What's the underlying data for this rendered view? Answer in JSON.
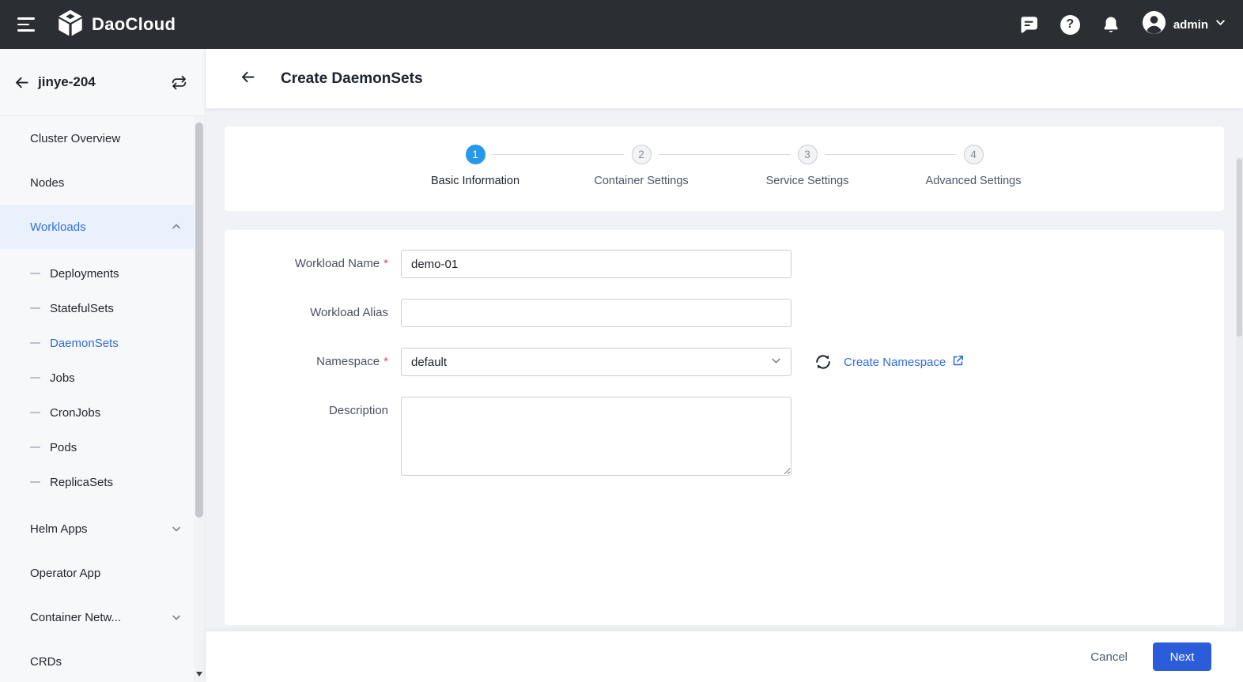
{
  "topbar": {
    "brand": "DaoCloud",
    "user": "admin",
    "icons": [
      "menu-icon",
      "cube-logo-icon",
      "chat-icon",
      "help-icon",
      "bell-icon",
      "avatar-icon",
      "chevron-down-icon"
    ]
  },
  "sidebar": {
    "cluster_name": "jinye-204",
    "header_icons": [
      "back-arrow-icon",
      "switch-cluster-icon"
    ],
    "items": [
      {
        "label": "Cluster Overview",
        "level": "top"
      },
      {
        "label": "Nodes",
        "level": "top"
      },
      {
        "label": "Workloads",
        "level": "top",
        "state": "expanded-active"
      },
      {
        "label": "Deployments",
        "level": "sub"
      },
      {
        "label": "StatefulSets",
        "level": "sub"
      },
      {
        "label": "DaemonSets",
        "level": "sub",
        "state": "selected"
      },
      {
        "label": "Jobs",
        "level": "sub"
      },
      {
        "label": "CronJobs",
        "level": "sub"
      },
      {
        "label": "Pods",
        "level": "sub"
      },
      {
        "label": "ReplicaSets",
        "level": "sub"
      },
      {
        "label": "Helm Apps",
        "level": "top",
        "state": "collapsed"
      },
      {
        "label": "Operator App",
        "level": "top"
      },
      {
        "label": "Container Netw...",
        "level": "top",
        "state": "collapsed"
      },
      {
        "label": "CRDs",
        "level": "top"
      }
    ]
  },
  "page": {
    "title": "Create DaemonSets"
  },
  "stepper": {
    "steps": [
      {
        "number": "1",
        "label": "Basic Information",
        "active": true
      },
      {
        "number": "2",
        "label": "Container Settings",
        "active": false
      },
      {
        "number": "3",
        "label": "Service Settings",
        "active": false
      },
      {
        "number": "4",
        "label": "Advanced Settings",
        "active": false
      }
    ]
  },
  "form": {
    "required_marker": "*",
    "workload_name": {
      "label": "Workload Name",
      "required": true,
      "value": "demo-01"
    },
    "workload_alias": {
      "label": "Workload Alias",
      "required": false,
      "value": ""
    },
    "namespace": {
      "label": "Namespace",
      "required": true,
      "value": "default",
      "create_link_label": "Create Namespace"
    },
    "description": {
      "label": "Description",
      "value": ""
    }
  },
  "footer": {
    "cancel_label": "Cancel",
    "next_label": "Next"
  },
  "colors": {
    "topbar_bg": "#2b2e33",
    "primary_button_blue": "#2b5cd9",
    "step_active_blue": "#2798ea",
    "link_blue": "#2f6cde",
    "sidebar_active_blue": "#3370d6",
    "required_red": "#e5484d"
  }
}
